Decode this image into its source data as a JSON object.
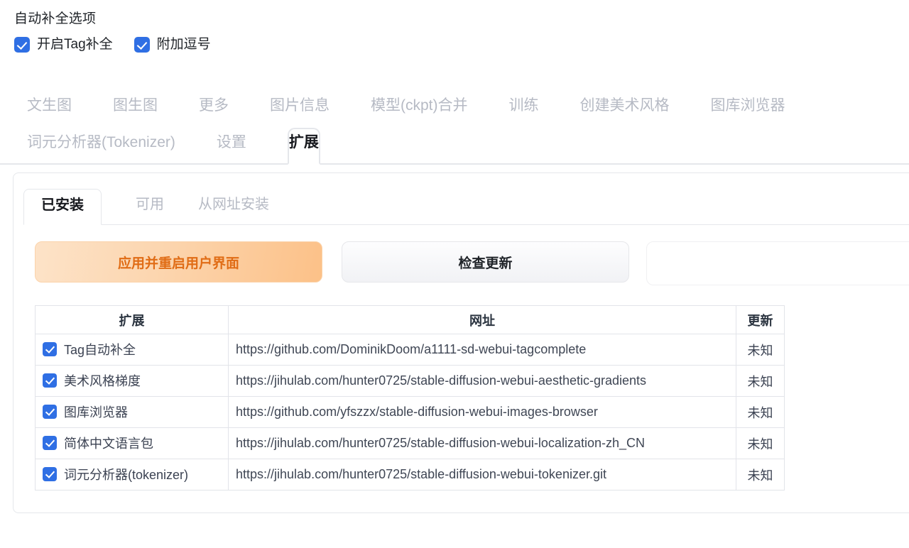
{
  "autocomplete": {
    "title": "自动补全选项",
    "options": [
      {
        "label": "开启Tag补全",
        "checked": true
      },
      {
        "label": "附加逗号",
        "checked": true
      }
    ]
  },
  "top_tabs": {
    "row1": [
      "文生图",
      "图生图",
      "更多",
      "图片信息",
      "模型(ckpt)合并",
      "训练",
      "创建美术风格",
      "图库浏览器"
    ],
    "row2": [
      "词元分析器(Tokenizer)",
      "设置",
      "扩展"
    ],
    "active": "扩展"
  },
  "extensions": {
    "inner_tabs": [
      "已安装",
      "可用",
      "从网址安装"
    ],
    "inner_active": "已安装",
    "buttons": {
      "apply": "应用并重启用户界面",
      "check_updates": "检查更新"
    },
    "table": {
      "headers": [
        "扩展",
        "网址",
        "更新"
      ],
      "rows": [
        {
          "checked": true,
          "name": "Tag自动补全",
          "url": "https://github.com/DominikDoom/a1111-sd-webui-tagcomplete",
          "update": "未知"
        },
        {
          "checked": true,
          "name": "美术风格梯度",
          "url": "https://jihulab.com/hunter0725/stable-diffusion-webui-aesthetic-gradients",
          "update": "未知"
        },
        {
          "checked": true,
          "name": "图库浏览器",
          "url": "https://github.com/yfszzx/stable-diffusion-webui-images-browser",
          "update": "未知"
        },
        {
          "checked": true,
          "name": "简体中文语言包",
          "url": "https://jihulab.com/hunter0725/stable-diffusion-webui-localization-zh_CN",
          "update": "未知"
        },
        {
          "checked": true,
          "name": "词元分析器(tokenizer)",
          "url": "https://jihulab.com/hunter0725/stable-diffusion-webui-tokenizer.git",
          "update": "未知"
        }
      ]
    }
  },
  "colors": {
    "accent_blue": "#2f6fe4",
    "apply_orange_text": "#e06c15",
    "apply_orange_bg": "#fcc188",
    "tab_inactive": "#b6bac4",
    "border": "#e5e7eb"
  }
}
